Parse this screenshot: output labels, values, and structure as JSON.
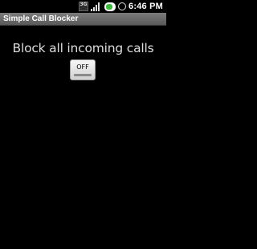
{
  "status_bar": {
    "network_label": "3G",
    "time": "6:46 PM",
    "icons": [
      "network-3g-icon",
      "signal-icon",
      "battery-icon",
      "alarm-icon"
    ]
  },
  "app": {
    "title": "Simple Call Blocker"
  },
  "main": {
    "label": "Block all incoming calls",
    "toggle": {
      "label": "OFF",
      "state": "off"
    }
  },
  "colors": {
    "background": "#000000",
    "title_bar": "#6b6b6b",
    "label_text": "#dcdcdc",
    "button_face": "#e6e6e6",
    "battery_fill": "#3db93d"
  }
}
